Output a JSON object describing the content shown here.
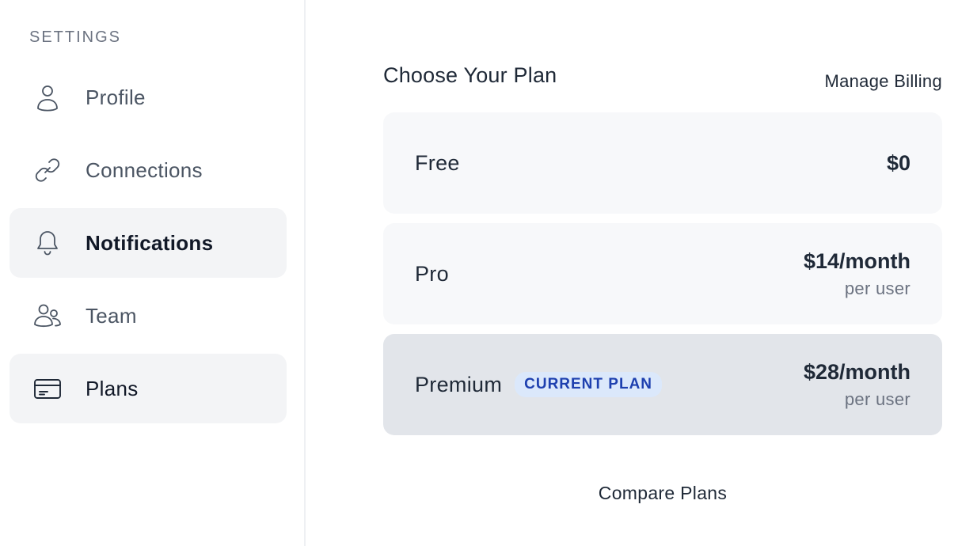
{
  "sidebar": {
    "heading": "SETTINGS",
    "items": [
      {
        "label": "Profile",
        "icon": "user-icon"
      },
      {
        "label": "Connections",
        "icon": "link-icon"
      },
      {
        "label": "Notifications",
        "icon": "bell-icon"
      },
      {
        "label": "Team",
        "icon": "team-icon"
      },
      {
        "label": "Plans",
        "icon": "credit-card-icon"
      }
    ]
  },
  "main": {
    "title": "Choose Your Plan",
    "manage_billing": "Manage Billing",
    "plans": [
      {
        "name": "Free",
        "price": "$0"
      },
      {
        "name": "Pro",
        "price": "$14/month",
        "sub": "per user"
      },
      {
        "name": "Premium",
        "badge": "CURRENT PLAN",
        "price": "$28/month",
        "sub": "per user"
      }
    ],
    "compare": "Compare Plans"
  },
  "colors": {
    "active_bg": "#f3f4f6",
    "card_bg": "#f7f8fa",
    "current_card_bg": "#e2e5ea",
    "badge_bg": "#dbe8fb",
    "badge_text": "#1e40af"
  }
}
